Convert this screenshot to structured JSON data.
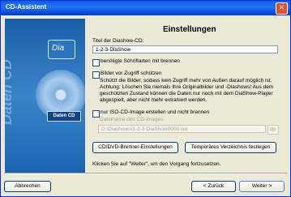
{
  "window": {
    "title": "CD-Assistent",
    "close_glyph": "✕"
  },
  "side_panel": {
    "vertical_text": "Daten CD",
    "dia_label": "Dia",
    "cd_label": "Daten CD"
  },
  "page": {
    "heading": "Einstellungen",
    "title_label": "Titel der Diashow-CD:",
    "title_value": "1-2-3-DiaShow",
    "fonts_option": "benötigte Schriftarten mit brennen",
    "protect_option": "Bilder vor Zugriff schützen",
    "protect_description_lines": [
      "Schützt die Bilder, sodass kein Zugriff mehr von Außen darauf möglich ist.",
      "Achtung: Löschen Sie niemals Ihre Originalbilder und -Diashows! Aus dem",
      "geschützten Zustand können die Daten nur noch mit dem DiaShow-Player",
      "abgespielt, aber nicht mehr extrahiert werden."
    ],
    "iso_option": "nur ISO-CD-Image erstellen und nicht brennen",
    "image_label": "Dateiname des CD-Images",
    "image_value": "D:\\Diashows\\1-2-3-DiaShow0000.iso",
    "burner_button": "CD/DVD-Brenner-Einstellungen",
    "temp_button": "Temporäres Verzeichnis festlegen",
    "hint": "Klicken Sie auf \"Weiter\", um den Vorgang fortzusetzen."
  },
  "footer": {
    "cancel": "Abbrechen",
    "back": "< Zurück",
    "next": "Weiter >"
  },
  "icons": {
    "close": "close-icon",
    "folder": "folder-icon"
  }
}
